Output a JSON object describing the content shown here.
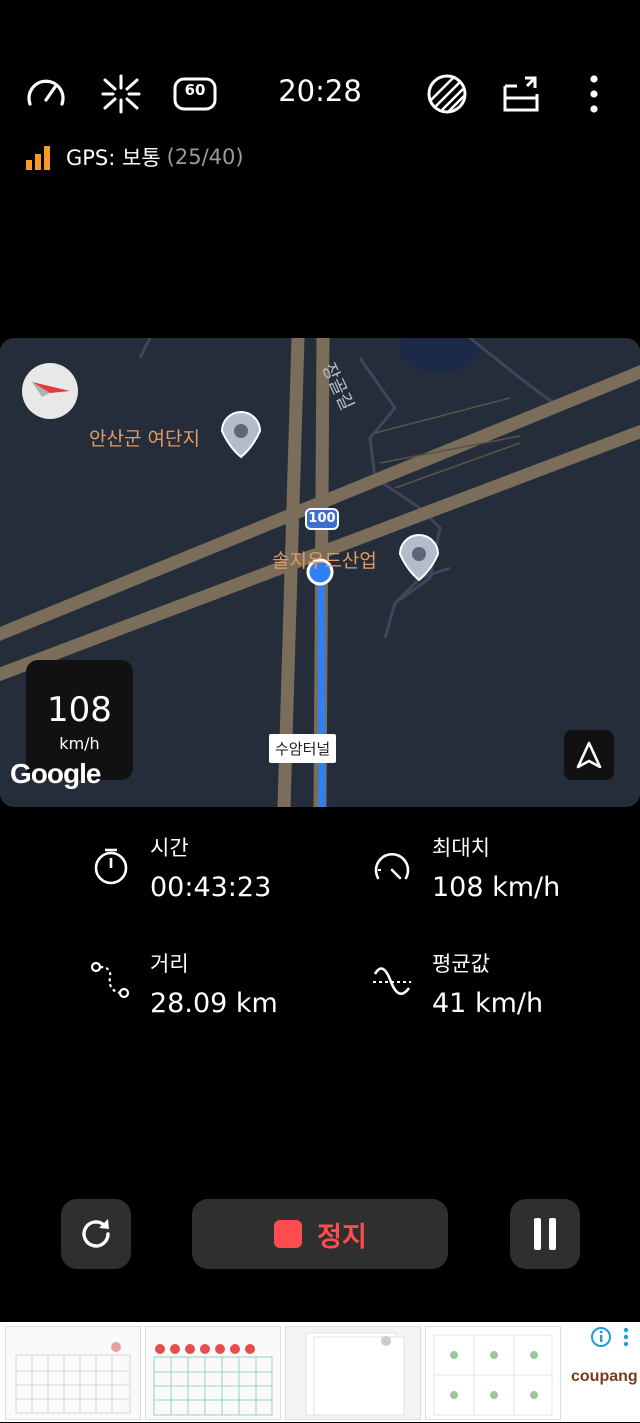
{
  "status": {
    "clock": "20:28",
    "gps_label": "GPS: 보통",
    "gps_count": "(25/40)",
    "speed_limit_value": "60"
  },
  "map": {
    "current_speed": "108",
    "current_speed_unit": "km/h",
    "poi_1": "안산군 여단지",
    "poi_2": "솔지우드산업",
    "road_label": "수암터널",
    "route_shield": "100",
    "street_label": "장골길",
    "attribution": "Google"
  },
  "stats": {
    "time_label": "시간",
    "time_value": "00:43:23",
    "max_label": "최대치",
    "max_value": "108 km/h",
    "distance_label": "거리",
    "distance_value": "28.09 km",
    "avg_label": "평균값",
    "avg_value": "41 km/h"
  },
  "controls": {
    "stop_label": "정지"
  },
  "ad": {
    "brand": "coupang"
  },
  "colors": {
    "accent_route": "#2f7ff5",
    "stop": "#ff4d4f",
    "gps_signal": "#f59a23",
    "poi_text": "#e49a63"
  },
  "icons": [
    "speedometer-icon",
    "hud-icon",
    "speed-limit-icon",
    "theme-icon",
    "window-icon",
    "more-icon",
    "signal-icon",
    "compass-icon",
    "navigation-arrow-icon",
    "timer-icon",
    "gauge-icon",
    "route-icon",
    "wave-icon",
    "reset-icon",
    "stop-icon",
    "pause-icon",
    "info-icon"
  ]
}
